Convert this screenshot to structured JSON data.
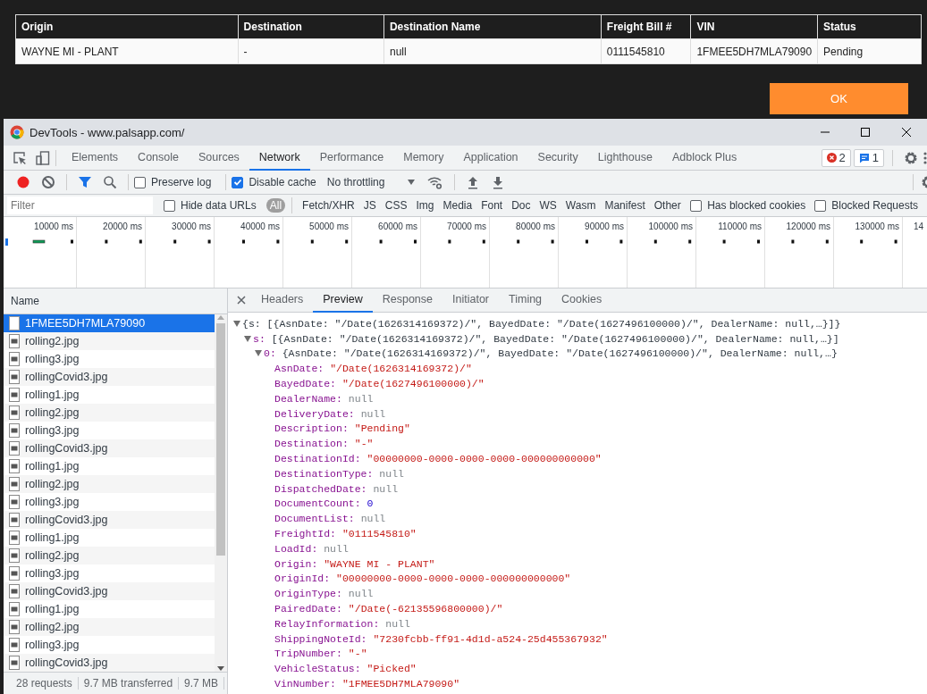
{
  "results_table": {
    "columns": [
      "Origin",
      "Destination",
      "Destination Name",
      "Freight Bill #",
      "VIN",
      "Status"
    ],
    "rows": [
      [
        "WAYNE MI - PLANT",
        "-",
        "null",
        "0111545810",
        "1FMEE5DH7MLA79090",
        "Pending"
      ]
    ]
  },
  "ok_button": "OK",
  "devtools": {
    "window_title": "DevTools - www.palsapp.com/",
    "tabs": [
      {
        "label": "Elements",
        "selected": false
      },
      {
        "label": "Console",
        "selected": false
      },
      {
        "label": "Sources",
        "selected": false
      },
      {
        "label": "Network",
        "selected": true
      },
      {
        "label": "Performance",
        "selected": false
      },
      {
        "label": "Memory",
        "selected": false
      },
      {
        "label": "Application",
        "selected": false
      },
      {
        "label": "Security",
        "selected": false
      },
      {
        "label": "Lighthouse",
        "selected": false
      },
      {
        "label": "Adblock Plus",
        "selected": false
      }
    ],
    "error_count": "2",
    "message_count": "1",
    "toolbar": {
      "preserve_log": {
        "label": "Preserve log",
        "checked": false
      },
      "disable_cache": {
        "label": "Disable cache",
        "checked": true
      },
      "throttling": "No throttling"
    },
    "filter": {
      "placeholder": "Filter",
      "hide_data_urls": {
        "label": "Hide data URLs",
        "checked": false
      },
      "types": [
        {
          "label": "All",
          "selected": true
        },
        {
          "label": "Fetch/XHR",
          "selected": false
        },
        {
          "label": "JS",
          "selected": false
        },
        {
          "label": "CSS",
          "selected": false
        },
        {
          "label": "Img",
          "selected": false
        },
        {
          "label": "Media",
          "selected": false
        },
        {
          "label": "Font",
          "selected": false
        },
        {
          "label": "Doc",
          "selected": false
        },
        {
          "label": "WS",
          "selected": false
        },
        {
          "label": "Wasm",
          "selected": false
        },
        {
          "label": "Manifest",
          "selected": false
        },
        {
          "label": "Other",
          "selected": false
        }
      ],
      "has_blocked_cookies": {
        "label": "Has blocked cookies",
        "checked": false
      },
      "blocked_requests": {
        "label": "Blocked Requests",
        "checked": false
      }
    },
    "overview": {
      "ticks": [
        "10000 ms",
        "20000 ms",
        "30000 ms",
        "40000 ms",
        "50000 ms",
        "60000 ms",
        "70000 ms",
        "80000 ms",
        "90000 ms",
        "100000 ms",
        "110000 ms",
        "120000 ms",
        "130000 ms",
        "14"
      ]
    },
    "requests": {
      "header": "Name",
      "items": [
        {
          "name": "1FMEE5DH7MLA79090",
          "kind": "document",
          "selected": true
        },
        {
          "name": "rolling2.jpg",
          "kind": "image",
          "selected": false
        },
        {
          "name": "rolling3.jpg",
          "kind": "image",
          "selected": false
        },
        {
          "name": "rollingCovid3.jpg",
          "kind": "image",
          "selected": false
        },
        {
          "name": "rolling1.jpg",
          "kind": "image",
          "selected": false
        },
        {
          "name": "rolling2.jpg",
          "kind": "image",
          "selected": false
        },
        {
          "name": "rolling3.jpg",
          "kind": "image",
          "selected": false
        },
        {
          "name": "rollingCovid3.jpg",
          "kind": "image",
          "selected": false
        },
        {
          "name": "rolling1.jpg",
          "kind": "image",
          "selected": false
        },
        {
          "name": "rolling2.jpg",
          "kind": "image",
          "selected": false
        },
        {
          "name": "rolling3.jpg",
          "kind": "image",
          "selected": false
        },
        {
          "name": "rollingCovid3.jpg",
          "kind": "image",
          "selected": false
        },
        {
          "name": "rolling1.jpg",
          "kind": "image",
          "selected": false
        },
        {
          "name": "rolling2.jpg",
          "kind": "image",
          "selected": false
        },
        {
          "name": "rolling3.jpg",
          "kind": "image",
          "selected": false
        },
        {
          "name": "rollingCovid3.jpg",
          "kind": "image",
          "selected": false
        },
        {
          "name": "rolling1.jpg",
          "kind": "image",
          "selected": false
        },
        {
          "name": "rolling2.jpg",
          "kind": "image",
          "selected": false
        },
        {
          "name": "rolling3.jpg",
          "kind": "image",
          "selected": false
        },
        {
          "name": "rollingCovid3.jpg",
          "kind": "image",
          "selected": false
        }
      ]
    },
    "status": [
      "28 requests",
      "9.7 MB transferred",
      "9.7 MB"
    ],
    "detail_tabs": [
      {
        "label": "Headers",
        "selected": false
      },
      {
        "label": "Preview",
        "selected": true
      },
      {
        "label": "Response",
        "selected": false
      },
      {
        "label": "Initiator",
        "selected": false
      },
      {
        "label": "Timing",
        "selected": false
      },
      {
        "label": "Cookies",
        "selected": false
      }
    ],
    "preview": {
      "summary": "{s: [{AsnDate: \"/Date(1626314169372)/\", BayedDate: \"/Date(1627496100000)/\", DealerName: null,…}]}",
      "expanded": true,
      "children": [
        {
          "key": "s:",
          "summary": "[{AsnDate: \"/Date(1626314169372)/\", BayedDate: \"/Date(1627496100000)/\", DealerName: null,…}]",
          "expanded": true,
          "children": [
            {
              "key": "0:",
              "summary": "{AsnDate: \"/Date(1626314169372)/\", BayedDate: \"/Date(1627496100000)/\", DealerName: null,…}",
              "expanded": true,
              "children": [
                {
                  "key": "AsnDate:",
                  "value": "\"/Date(1626314169372)/\"",
                  "kind": "string"
                },
                {
                  "key": "BayedDate:",
                  "value": "\"/Date(1627496100000)/\"",
                  "kind": "string"
                },
                {
                  "key": "DealerName:",
                  "value": "null",
                  "kind": "null"
                },
                {
                  "key": "DeliveryDate:",
                  "value": "null",
                  "kind": "null"
                },
                {
                  "key": "Description:",
                  "value": "\"Pending\"",
                  "kind": "string"
                },
                {
                  "key": "Destination:",
                  "value": "\"-\"",
                  "kind": "string"
                },
                {
                  "key": "DestinationId:",
                  "value": "\"00000000-0000-0000-0000-000000000000\"",
                  "kind": "string"
                },
                {
                  "key": "DestinationType:",
                  "value": "null",
                  "kind": "null"
                },
                {
                  "key": "DispatchedDate:",
                  "value": "null",
                  "kind": "null"
                },
                {
                  "key": "DocumentCount:",
                  "value": "0",
                  "kind": "number"
                },
                {
                  "key": "DocumentList:",
                  "value": "null",
                  "kind": "null"
                },
                {
                  "key": "FreightId:",
                  "value": "\"0111545810\"",
                  "kind": "string"
                },
                {
                  "key": "LoadId:",
                  "value": "null",
                  "kind": "null"
                },
                {
                  "key": "Origin:",
                  "value": "\"WAYNE MI - PLANT\"",
                  "kind": "string"
                },
                {
                  "key": "OriginId:",
                  "value": "\"00000000-0000-0000-0000-000000000000\"",
                  "kind": "string"
                },
                {
                  "key": "OriginType:",
                  "value": "null",
                  "kind": "null"
                },
                {
                  "key": "PairedDate:",
                  "value": "\"/Date(-62135596800000)/\"",
                  "kind": "string"
                },
                {
                  "key": "RelayInformation:",
                  "value": "null",
                  "kind": "null"
                },
                {
                  "key": "ShippingNoteId:",
                  "value": "\"7230fcbb-ff91-4d1d-a524-25d455367932\"",
                  "kind": "string"
                },
                {
                  "key": "TripNumber:",
                  "value": "\"-\"",
                  "kind": "string"
                },
                {
                  "key": "VehicleStatus:",
                  "value": "\"Picked\"",
                  "kind": "string"
                },
                {
                  "key": "VinNumber:",
                  "value": "\"1FMEE5DH7MLA79090\"",
                  "kind": "string"
                }
              ]
            }
          ]
        }
      ]
    }
  }
}
